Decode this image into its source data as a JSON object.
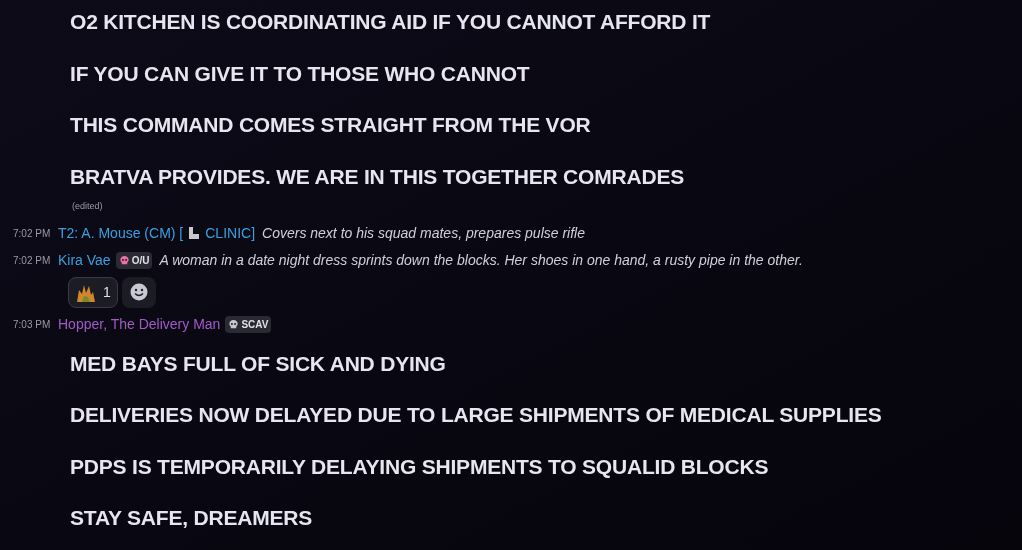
{
  "blocks": [
    {
      "kind": "announcement",
      "lines": [
        "O2 KITCHEN IS COORDINATING AID IF YOU CANNOT AFFORD IT",
        "IF YOU CAN GIVE IT TO THOSE WHO CANNOT",
        "THIS COMMAND COMES STRAIGHT FROM THE VOR",
        "BRATVA PROVIDES. WE ARE IN THIS TOGETHER COMRADES"
      ],
      "edited": "(edited)"
    },
    {
      "kind": "message",
      "time": "7:02 PM",
      "author": "T2: A. Mouse (CM) [",
      "author_suffix": "CLINIC]",
      "color": "#3ba0e0",
      "text": "Covers next to his squad mates, prepares pulse rifle"
    },
    {
      "kind": "message",
      "time": "7:02 PM",
      "author": "Kira Vae",
      "color": "#3ba0e0",
      "tag": {
        "label": "O/U",
        "color": "#f06fa8"
      },
      "text": "A woman in a date night dress sprints down the blocks. Her shoes in one hand, a rusty pipe in the other.",
      "reactions": [
        {
          "count": "1"
        }
      ]
    },
    {
      "kind": "message",
      "time": "7:03 PM",
      "author": "Hopper, The Delivery Man",
      "color": "#a25ac9",
      "tag": {
        "label": "SCAV",
        "color": "#c8c8cc"
      }
    },
    {
      "kind": "announcement",
      "lines": [
        "MED BAYS FULL OF SICK AND DYING",
        "DELIVERIES NOW DELAYED DUE TO LARGE SHIPMENTS OF MEDICAL SUPPLIES",
        "PDPS IS TEMPORARILY DELAYING SHIPMENTS TO SQUALID BLOCKS",
        "STAY SAFE, DREAMERS"
      ]
    }
  ]
}
